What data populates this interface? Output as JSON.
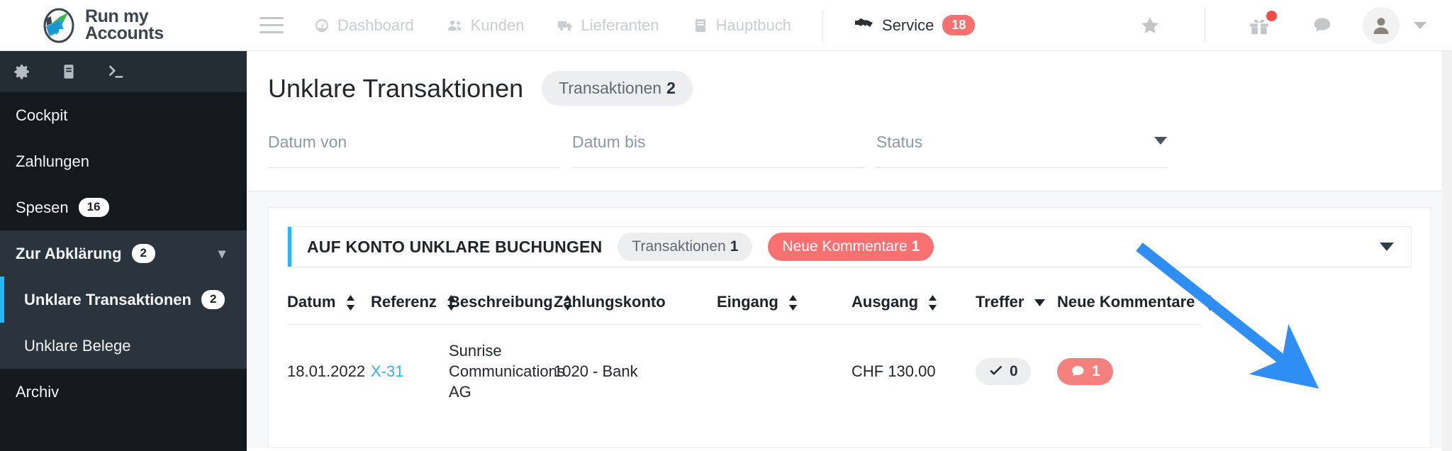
{
  "brand": {
    "line1": "Run my",
    "line2": "Accounts"
  },
  "topnav": {
    "menu_icon": "hamburger-icon",
    "items": [
      {
        "label": "Dashboard",
        "icon": "dashboard-gauge-icon",
        "active": false
      },
      {
        "label": "Kunden",
        "icon": "users-icon",
        "active": false
      },
      {
        "label": "Lieferanten",
        "icon": "truck-icon",
        "active": false
      },
      {
        "label": "Hauptbuch",
        "icon": "book-icon",
        "active": false
      }
    ],
    "service": {
      "label": "Service",
      "icon": "handshake-icon",
      "badge": "18",
      "badge_color": "#f87171"
    },
    "right": {
      "star": "star-icon",
      "gift": "gift-icon",
      "gift_dot_color": "#fb4a4a",
      "chat": "chat-bubble-icon",
      "avatar": "user-avatar-icon",
      "caret": "chevron-down-icon"
    }
  },
  "sidebar": {
    "tools": [
      "gear-icon",
      "book-icon",
      "terminal-icon"
    ],
    "items": [
      {
        "label": "Cockpit",
        "badge": "",
        "bold": false,
        "active": false,
        "indent": false
      },
      {
        "label": "Zahlungen",
        "badge": "",
        "bold": false,
        "active": false,
        "indent": false
      },
      {
        "label": "Spesen",
        "badge": "16",
        "bold": false,
        "active": false,
        "indent": false
      }
    ],
    "group": {
      "label": "Zur Abklärung",
      "badge": "2",
      "chevron": "chevron-down-icon",
      "children": [
        {
          "label": "Unklare Transaktionen",
          "badge": "2",
          "active": true
        },
        {
          "label": "Unklare Belege",
          "badge": "",
          "active": false
        }
      ]
    },
    "archive": {
      "label": "Archiv",
      "badge": ""
    },
    "accent_color": "#29b6f6"
  },
  "page": {
    "title": "Unklare Transaktionen",
    "title_pill": {
      "label": "Transaktionen",
      "count": "2"
    }
  },
  "filters": {
    "datum_von": {
      "label": "Datum von",
      "value": ""
    },
    "datum_bis": {
      "label": "Datum bis",
      "value": ""
    },
    "status": {
      "label": "Status",
      "value": ""
    }
  },
  "card": {
    "title": "AUF KONTO UNKLARE BUCHUNGEN",
    "pill_transaktionen": {
      "label": "Transaktionen",
      "count": "1"
    },
    "pill_kommentare": {
      "label": "Neue Kommentare",
      "count": "1"
    },
    "collapse_icon": "caret-down-icon",
    "accent_color": "#29b6f6"
  },
  "table": {
    "columns": [
      {
        "label": "Datum",
        "sort": "both"
      },
      {
        "label": "Referenz",
        "sort": "both"
      },
      {
        "label": "Beschreibung",
        "sort": "both"
      },
      {
        "label": "Zahlungskonto",
        "sort": "none"
      },
      {
        "label": "Eingang",
        "sort": "both"
      },
      {
        "label": "Ausgang",
        "sort": "both"
      },
      {
        "label": "Treffer",
        "sort": "down"
      },
      {
        "label": "Neue Kommentare",
        "sort": "both"
      }
    ],
    "rows": [
      {
        "datum": "18.01.2022",
        "referenz": "X-31",
        "beschreibung": "Sunrise Communications AG",
        "zahlungskonto": "1020 - Bank",
        "eingang": "",
        "ausgang": "CHF 130.00",
        "treffer": "0",
        "neue_kommentare": "1"
      }
    ]
  },
  "annotation": {
    "type": "arrow",
    "color": "#2f8ef4",
    "points_to": "neue-kommentare-chip"
  }
}
